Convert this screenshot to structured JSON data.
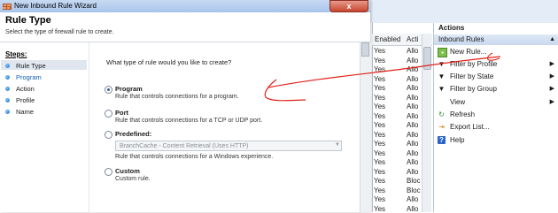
{
  "window": {
    "title": "New Inbound Rule Wizard",
    "close_glyph": "x"
  },
  "header": {
    "title": "Rule Type",
    "subtitle": "Select the type of firewall rule to create."
  },
  "steps": {
    "label": "Steps:",
    "items": [
      {
        "label": "Rule Type"
      },
      {
        "label": "Program"
      },
      {
        "label": "Action"
      },
      {
        "label": "Profile"
      },
      {
        "label": "Name"
      }
    ]
  },
  "main": {
    "question": "What type of rule would you like to create?",
    "options": [
      {
        "title": "Program",
        "desc": "Rule that controls connections for a program.",
        "selected": true
      },
      {
        "title": "Port",
        "desc": "Rule that controls connections for a TCP or UDP port.",
        "selected": false
      },
      {
        "title": "Predefined:",
        "desc": "Rule that controls connections for a Windows experience.",
        "selected": false
      },
      {
        "title": "Custom",
        "desc": "Custom rule.",
        "selected": false
      }
    ],
    "predefined_value": "BranchCache - Content Retrieval (Uses HTTP)"
  },
  "table": {
    "columns": [
      "Enabled",
      "Acti"
    ],
    "rows": [
      [
        "Yes",
        "Allo"
      ],
      [
        "Yes",
        "Allo"
      ],
      [
        "Yes",
        "Allo"
      ],
      [
        "Yes",
        "Allo"
      ],
      [
        "Yes",
        "Allo"
      ],
      [
        "Yes",
        "Allo"
      ],
      [
        "Yes",
        "Allo"
      ],
      [
        "Yes",
        "Allo"
      ],
      [
        "Yes",
        "Allo"
      ],
      [
        "Yes",
        "Allo"
      ],
      [
        "Yes",
        "Allo"
      ],
      [
        "Yes",
        "Allo"
      ],
      [
        "Yes",
        "Allo"
      ],
      [
        "Yes",
        "Allo"
      ],
      [
        "Yes",
        "Bloc"
      ],
      [
        "Yes",
        "Bloc"
      ],
      [
        "Yes",
        "Allo"
      ],
      [
        "Yes",
        "Allo"
      ]
    ]
  },
  "actions": {
    "title": "Actions",
    "group": "Inbound Rules",
    "items": [
      {
        "label": "New Rule...",
        "icon": "new-rule-icon",
        "submenu": false
      },
      {
        "label": "Filter by Profile",
        "icon": "filter-icon",
        "submenu": true
      },
      {
        "label": "Filter by State",
        "icon": "filter-icon",
        "submenu": true
      },
      {
        "label": "Filter by Group",
        "icon": "filter-icon",
        "submenu": true
      },
      {
        "label": "View",
        "icon": "",
        "submenu": true
      },
      {
        "label": "Refresh",
        "icon": "refresh-icon",
        "submenu": false
      },
      {
        "label": "Export List...",
        "icon": "export-icon",
        "submenu": false
      },
      {
        "label": "Help",
        "icon": "help-icon",
        "submenu": false
      }
    ]
  },
  "colors": {
    "annotation": "#e0201a",
    "accent": "#0f5fb4"
  }
}
